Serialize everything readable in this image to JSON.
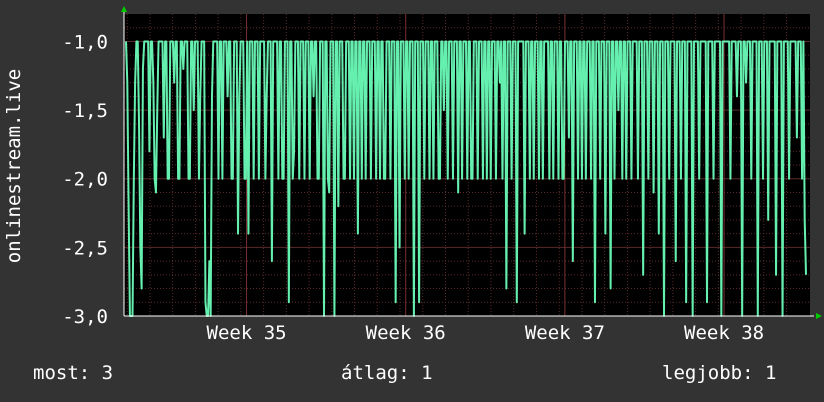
{
  "chart_data": {
    "type": "line",
    "ylabel": "onlinestream.live",
    "ylim": [
      -3.0,
      -0.8
    ],
    "yticks": [
      "-1,0",
      "-1,5",
      "-2,0",
      "-2,5",
      "-3,0"
    ],
    "ytick_values": [
      -1.0,
      -1.5,
      -2.0,
      -2.5,
      -3.0
    ],
    "xticks": [
      "Week 35",
      "Week 36",
      "Week 37",
      "Week 38"
    ],
    "xtick_values": [
      35,
      36,
      37,
      38
    ],
    "xlim": [
      34.23,
      38.54
    ],
    "grid": true,
    "background": "#000000",
    "grid_color": "#5a2a2a",
    "line_color": "#66f0b0",
    "series": [
      {
        "values": [
          -1.0,
          -1.3,
          -2.2,
          -3.0,
          -3.0,
          -3.0,
          -2.0,
          -1.3,
          -1.0,
          -1.0,
          -1.6,
          -2.5,
          -2.8,
          -1.2,
          -1.0,
          -1.0,
          -1.0,
          -1.0,
          -1.8,
          -1.0,
          -1.0,
          -1.3,
          -2.0,
          -2.1,
          -1.5,
          -1.0,
          -1.0,
          -1.0,
          -1.0,
          -1.7,
          -1.0,
          -1.0,
          -2.0,
          -2.0,
          -1.0,
          -1.0,
          -1.0,
          -1.3,
          -1.0,
          -1.0,
          -2.0,
          -2.0,
          -1.0,
          -1.0,
          -1.2,
          -1.0,
          -1.0,
          -1.0,
          -2.0,
          -2.0,
          -1.0,
          -1.0,
          -1.5,
          -1.0,
          -1.0,
          -1.0,
          -2.0,
          -1.4,
          -1.0,
          -1.0,
          -1.0,
          -2.9,
          -3.0,
          -3.0,
          -2.6,
          -3.0,
          -1.4,
          -1.0,
          -1.0,
          -1.0,
          -1.0,
          -2.0,
          -1.0,
          -1.0,
          -2.0,
          -1.0,
          -1.0,
          -1.0,
          -1.4,
          -1.0,
          -1.0,
          -2.0,
          -2.0,
          -1.0,
          -1.0,
          -1.0,
          -2.4,
          -1.4,
          -1.0,
          -1.0,
          -1.0,
          -2.0,
          -2.0,
          -1.0,
          -2.4,
          -1.0,
          -1.0,
          -1.0,
          -2.0,
          -1.0,
          -1.0,
          -1.0,
          -2.0,
          -1.0,
          -1.0,
          -1.0,
          -1.0,
          -2.0,
          -1.4,
          -1.0,
          -1.0,
          -1.0,
          -2.6,
          -1.0,
          -1.0,
          -1.0,
          -1.0,
          -2.0,
          -1.0,
          -1.0,
          -2.0,
          -2.0,
          -1.0,
          -1.0,
          -1.0,
          -2.9,
          -1.0,
          -1.0,
          -2.0,
          -1.8,
          -1.0,
          -1.0,
          -1.0,
          -2.0,
          -1.0,
          -1.0,
          -1.0,
          -2.0,
          -1.0,
          -1.0,
          -1.0,
          -2.0,
          -1.0,
          -1.0,
          -1.4,
          -1.0,
          -1.0,
          -2.0,
          -2.0,
          -1.0,
          -1.0,
          -1.0,
          -3.0,
          -1.0,
          -1.0,
          -2.0,
          -2.1,
          -1.0,
          -1.0,
          -1.0,
          -3.0,
          -1.0,
          -1.0,
          -2.2,
          -1.0,
          -1.0,
          -1.0,
          -2.0,
          -2.0,
          -1.0,
          -1.0,
          -1.0,
          -2.0,
          -1.0,
          -1.0,
          -2.0,
          -1.0,
          -1.0,
          -2.4,
          -1.0,
          -1.0,
          -2.0,
          -1.0,
          -1.0,
          -2.0,
          -1.0,
          -1.0,
          -1.0,
          -2.0,
          -1.0,
          -1.0,
          -1.0,
          -2.0,
          -1.0,
          -1.0,
          -2.0,
          -1.0,
          -1.0,
          -2.0,
          -2.0,
          -1.0,
          -1.0,
          -1.0,
          -2.0,
          -1.0,
          -1.0,
          -1.0,
          -2.9,
          -1.0,
          -1.0,
          -2.5,
          -1.0,
          -1.0,
          -1.0,
          -2.0,
          -1.0,
          -1.0,
          -2.0,
          -1.0,
          -1.0,
          -1.0,
          -3.0,
          -1.0,
          -1.0,
          -1.0,
          -2.9,
          -1.0,
          -1.0,
          -1.0,
          -2.0,
          -1.0,
          -1.0,
          -1.0,
          -2.0,
          -1.0,
          -1.0,
          -2.0,
          -1.0,
          -1.0,
          -1.0,
          -2.0,
          -2.0,
          -1.0,
          -1.0,
          -1.5,
          -1.0,
          -1.0,
          -2.0,
          -1.0,
          -1.0,
          -1.0,
          -2.0,
          -1.0,
          -1.0,
          -1.0,
          -2.1,
          -1.0,
          -1.0,
          -2.0,
          -1.0,
          -1.0,
          -1.0,
          -2.0,
          -1.0,
          -1.0,
          -2.0,
          -2.0,
          -1.0,
          -1.0,
          -1.0,
          -2.0,
          -1.0,
          -1.0,
          -1.0,
          -2.0,
          -1.0,
          -1.0,
          -2.0,
          -1.0,
          -1.0,
          -2.0,
          -1.0,
          -1.0,
          -1.0,
          -2.0,
          -1.0,
          -1.0,
          -1.3,
          -1.0,
          -2.0,
          -1.0,
          -1.0,
          -2.8,
          -1.0,
          -1.0,
          -1.0,
          -2.0,
          -1.0,
          -1.0,
          -1.0,
          -2.9,
          -1.0,
          -1.0,
          -1.0,
          -1.0,
          -1.0,
          -2.4,
          -1.0,
          -1.0,
          -1.0,
          -2.0,
          -1.0,
          -1.0,
          -2.0,
          -1.0,
          -1.0,
          -1.0,
          -2.0,
          -1.0,
          -1.0,
          -2.0,
          -1.0,
          -1.0,
          -1.0,
          -1.0,
          -2.0,
          -1.0,
          -1.0,
          -2.0,
          -1.0,
          -1.0,
          -1.0,
          -2.0,
          -1.0,
          -1.0,
          -2.0,
          -2.0,
          -1.0,
          -1.0,
          -1.0,
          -1.7,
          -1.0,
          -1.0,
          -2.6,
          -1.0,
          -1.0,
          -1.0,
          -2.0,
          -1.0,
          -1.0,
          -2.0,
          -1.0,
          -1.0,
          -2.0,
          -1.0,
          -1.0,
          -1.0,
          -2.0,
          -1.0,
          -1.0,
          -2.9,
          -1.0,
          -1.0,
          -1.0,
          -2.0,
          -1.0,
          -1.0,
          -1.0,
          -2.4,
          -1.0,
          -1.0,
          -1.0,
          -2.8,
          -1.0,
          -1.0,
          -2.0,
          -1.0,
          -1.0,
          -1.5,
          -1.0,
          -1.0,
          -2.0,
          -1.0,
          -1.0,
          -2.0,
          -1.0,
          -1.0,
          -1.0,
          -2.0,
          -1.0,
          -1.0,
          -1.0,
          -1.0,
          -2.0,
          -1.0,
          -1.0,
          -1.0,
          -2.7,
          -1.0,
          -1.0,
          -1.0,
          -2.0,
          -1.0,
          -1.0,
          -1.0,
          -2.1,
          -1.0,
          -1.0,
          -1.0,
          -2.4,
          -1.0,
          -1.0,
          -1.0,
          -3.0,
          -1.0,
          -1.0,
          -1.0,
          -2.0,
          -1.0,
          -1.0,
          -1.0,
          -1.0,
          -2.6,
          -1.0,
          -1.0,
          -1.0,
          -2.0,
          -1.0,
          -1.0,
          -1.0,
          -2.9,
          -1.0,
          -1.0,
          -1.0,
          -1.0,
          -3.0,
          -1.0,
          -1.0,
          -1.0,
          -1.0,
          -2.0,
          -1.0,
          -1.0,
          -1.0,
          -1.0,
          -1.0,
          -2.9,
          -1.0,
          -1.0,
          -1.0,
          -1.0,
          -2.0,
          -1.0,
          -1.0,
          -1.0,
          -1.0,
          -1.0,
          -3.0,
          -1.0,
          -1.0,
          -1.0,
          -1.0,
          -1.0,
          -1.0,
          -2.0,
          -1.0,
          -1.0,
          -1.0,
          -1.0,
          -1.4,
          -1.0,
          -1.0,
          -1.0,
          -3.0,
          -1.0,
          -1.0,
          -1.3,
          -1.0,
          -1.0,
          -1.0,
          -2.0,
          -1.0,
          -1.0,
          -1.0,
          -1.0,
          -3.0,
          -1.0,
          -1.0,
          -1.0,
          -2.0,
          -1.0,
          -1.0,
          -1.0,
          -2.3,
          -1.0,
          -1.0,
          -1.0,
          -1.0,
          -1.0,
          -2.7,
          -1.0,
          -1.0,
          -1.0,
          -1.0,
          -3.0,
          -1.0,
          -1.0,
          -1.0,
          -1.0,
          -2.0,
          -1.0,
          -1.0,
          -1.0,
          -1.0,
          -1.0,
          -1.7,
          -1.0,
          -1.0,
          -1.0,
          -2.0,
          -1.0,
          -2.3,
          -2.7
        ]
      }
    ]
  },
  "footer": {
    "now": "most: 3",
    "avg": "átlag: 1",
    "best": "legjobb: 1"
  }
}
